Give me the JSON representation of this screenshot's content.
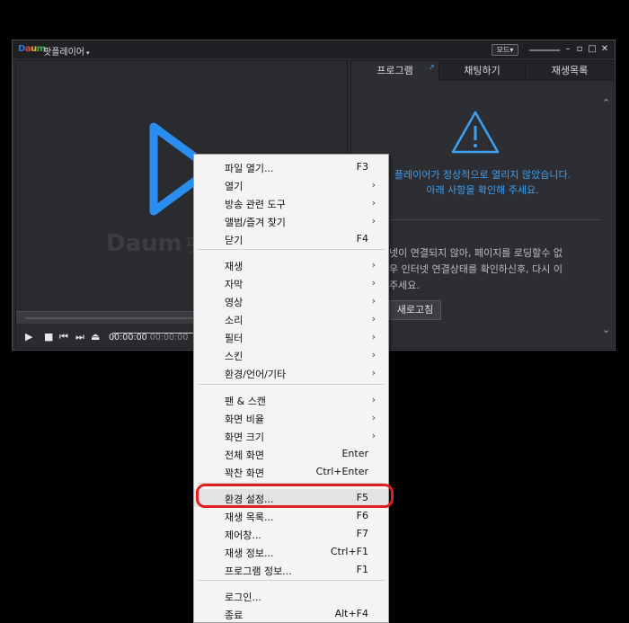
{
  "window": {
    "logo": [
      "D",
      "a",
      "u",
      "m"
    ],
    "title": "팟플레이어",
    "title_caret": "▾",
    "mode_label": "모드▾",
    "buttons": {
      "minimize": "–",
      "restore": "▫",
      "maximize": "□",
      "close": "✕"
    }
  },
  "player": {
    "watermark": "Daum",
    "watermark_suffix": "팟플",
    "time_current": "00:00:00",
    "time_sep": "/",
    "time_total": "00:00:00"
  },
  "sidebar": {
    "tabs": [
      {
        "label": "프로그램",
        "active": true
      },
      {
        "label": "채팅하기",
        "active": false
      },
      {
        "label": "재생목록",
        "active": false
      }
    ],
    "tab_ext": "↗",
    "error_line1": "플레이어가 정상적으로 열리지 않았습니다.",
    "error_line2": "아래 사항을 확인해 주세요.",
    "info_line1": "넷이 연결되지 않아, 페이지를 로딩할수 없",
    "info_line2": "우 인터넷 연결상태를 확인하신후, 다시 이",
    "info_line3": "주세요.",
    "refresh_label": "새로고침",
    "accent": "#3ea0f0"
  },
  "menu": {
    "items": [
      {
        "label": "파일 열기...",
        "shortcut": "F3",
        "submenu": false
      },
      {
        "label": "열기",
        "shortcut": "",
        "submenu": true
      },
      {
        "label": "방송 관련 도구",
        "shortcut": "",
        "submenu": true
      },
      {
        "label": "앨범/즐겨 찾기",
        "shortcut": "",
        "submenu": true
      },
      {
        "label": "닫기",
        "shortcut": "F4",
        "submenu": false
      },
      {
        "label": "재생",
        "shortcut": "",
        "submenu": true
      },
      {
        "label": "자막",
        "shortcut": "",
        "submenu": true
      },
      {
        "label": "영상",
        "shortcut": "",
        "submenu": true
      },
      {
        "label": "소리",
        "shortcut": "",
        "submenu": true
      },
      {
        "label": "필터",
        "shortcut": "",
        "submenu": true
      },
      {
        "label": "스킨",
        "shortcut": "",
        "submenu": true
      },
      {
        "label": "환경/언어/기타",
        "shortcut": "",
        "submenu": true
      },
      {
        "label": "팬 & 스캔",
        "shortcut": "",
        "submenu": true
      },
      {
        "label": "화면 비율",
        "shortcut": "",
        "submenu": true
      },
      {
        "label": "화면 크기",
        "shortcut": "",
        "submenu": true
      },
      {
        "label": "전체 화면",
        "shortcut": "Enter",
        "submenu": false
      },
      {
        "label": "꽉찬 화면",
        "shortcut": "Ctrl+Enter",
        "submenu": false
      },
      {
        "label": "환경 설정...",
        "shortcut": "F5",
        "submenu": false,
        "highlighted": true
      },
      {
        "label": "재생 목록...",
        "shortcut": "F6",
        "submenu": false
      },
      {
        "label": "제어창...",
        "shortcut": "F7",
        "submenu": false
      },
      {
        "label": "재생 정보...",
        "shortcut": "Ctrl+F1",
        "submenu": false
      },
      {
        "label": "프로그램 정보...",
        "shortcut": "F1",
        "submenu": false
      },
      {
        "label": "로그인...",
        "shortcut": "",
        "submenu": false
      },
      {
        "label": "종료",
        "shortcut": "Alt+F4",
        "submenu": false
      }
    ],
    "submenu_arrow": "›",
    "highlight_color": "#e02020"
  }
}
